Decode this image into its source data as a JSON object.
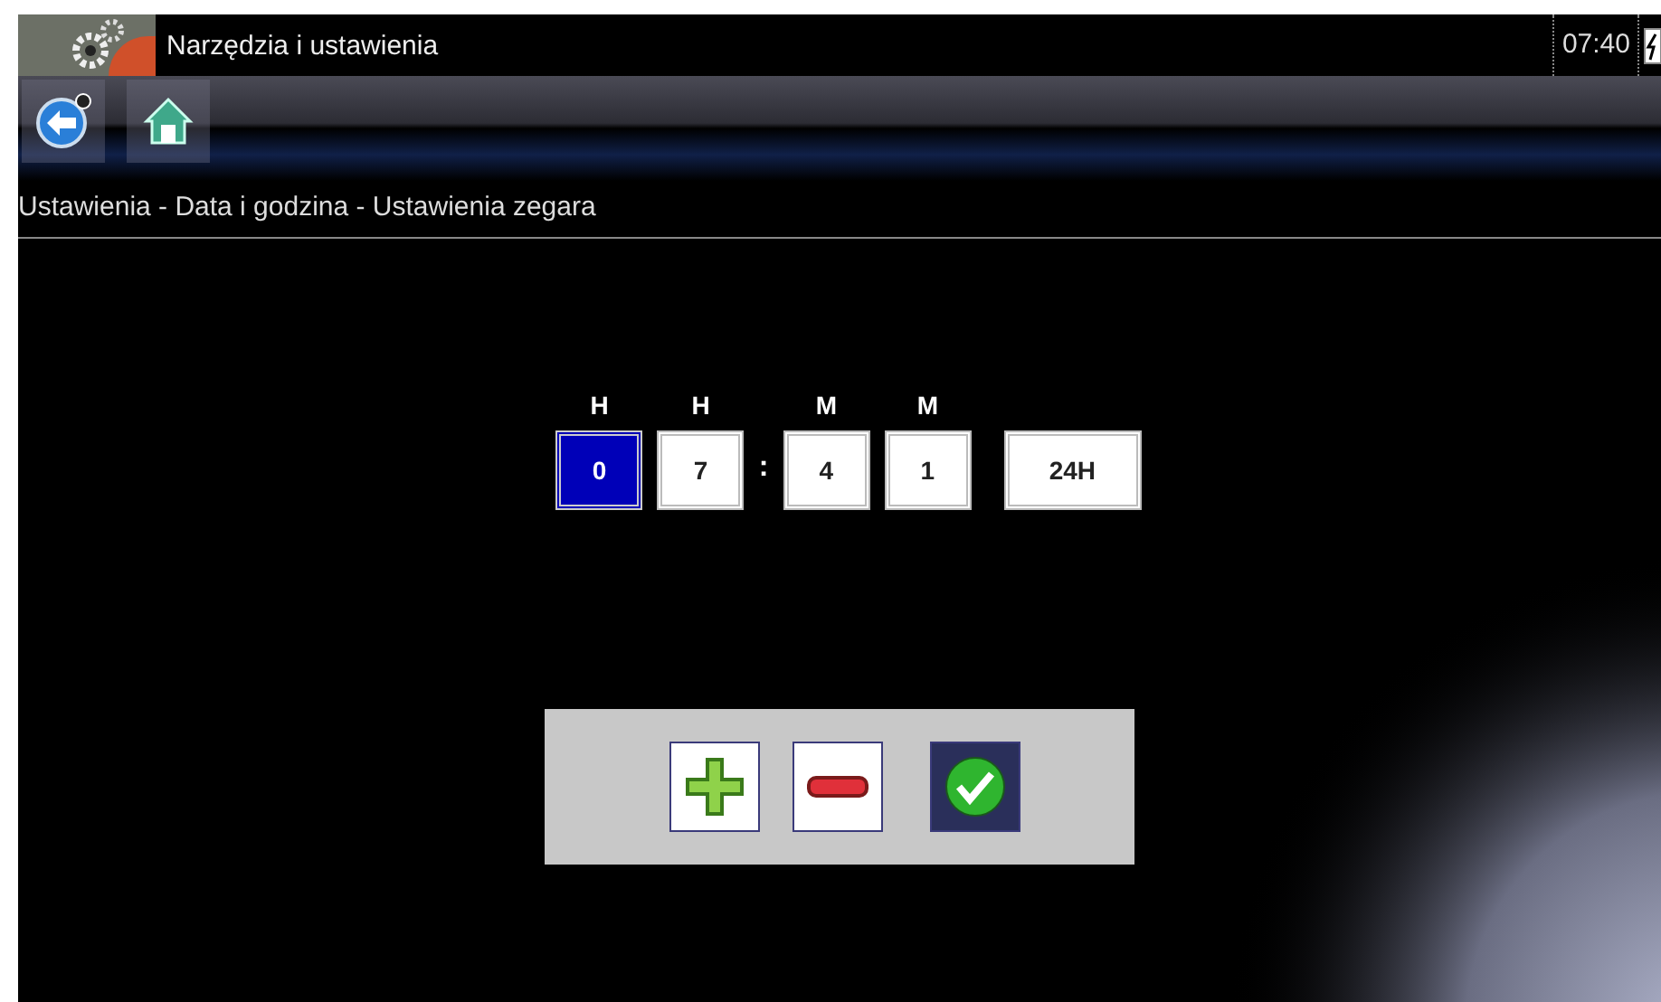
{
  "window": {
    "title": "Narzędzia i ustawienia",
    "time": "07:40"
  },
  "breadcrumb": "Ustawienia - Data i godzina - Ustawienia zegara",
  "clock": {
    "digits": [
      {
        "label": "H",
        "value": "0",
        "selected": true
      },
      {
        "label": "H",
        "value": "7",
        "selected": false
      },
      {
        "label": "M",
        "value": "4",
        "selected": false
      },
      {
        "label": "M",
        "value": "1",
        "selected": false
      }
    ],
    "separator": ":",
    "format": "24H"
  },
  "buttons": [
    {
      "kind": "plus"
    },
    {
      "kind": "minus"
    },
    {
      "kind": "confirm"
    }
  ]
}
